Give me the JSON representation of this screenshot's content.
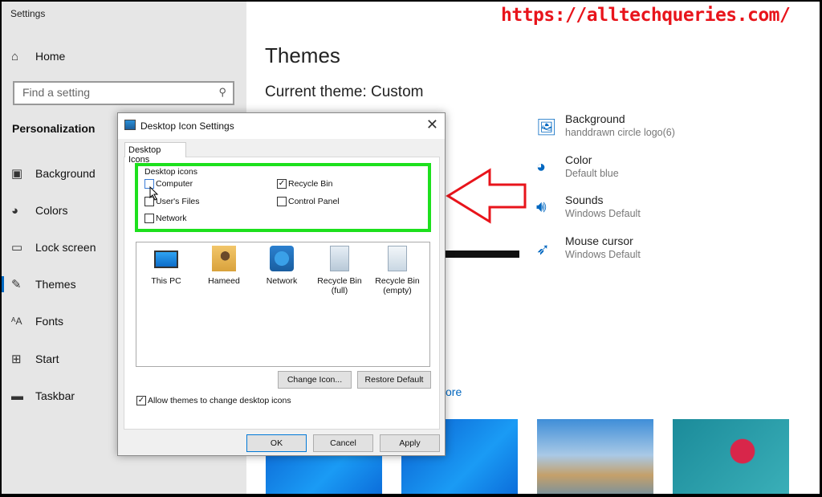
{
  "watermark_url": "https://alltechqueries.com/",
  "sidebar": {
    "app_title": "Settings",
    "home": "Home",
    "search_placeholder": "Find a setting",
    "section": "Personalization",
    "items": [
      {
        "label": "Background",
        "icon": "image-icon"
      },
      {
        "label": "Colors",
        "icon": "palette-icon"
      },
      {
        "label": "Lock screen",
        "icon": "lock-screen-icon"
      },
      {
        "label": "Themes",
        "icon": "themes-icon",
        "active": true
      },
      {
        "label": "Fonts",
        "icon": "fonts-icon"
      },
      {
        "label": "Start",
        "icon": "start-icon"
      },
      {
        "label": "Taskbar",
        "icon": "taskbar-icon"
      }
    ]
  },
  "main": {
    "title": "Themes",
    "current_theme": "Current theme: Custom",
    "settings": [
      {
        "title": "Background",
        "sub": "handdrawn circle logo(6)",
        "icon": "image-icon"
      },
      {
        "title": "Color",
        "sub": "Default blue",
        "icon": "palette-icon"
      },
      {
        "title": "Sounds",
        "sub": "Windows Default",
        "icon": "speaker-icon"
      },
      {
        "title": "Mouse cursor",
        "sub": "Windows Default",
        "icon": "cursor-icon"
      }
    ],
    "partial_link": "ore",
    "accent": "#0067c0"
  },
  "dialog": {
    "title": "Desktop Icon Settings",
    "tab": "Desktop Icons",
    "group_label": "Desktop icons",
    "checkboxes": [
      {
        "label": "Computer",
        "checked": false
      },
      {
        "label": "User's Files",
        "checked": false
      },
      {
        "label": "Network",
        "checked": false
      },
      {
        "label": "Recycle Bin",
        "checked": true
      },
      {
        "label": "Control Panel",
        "checked": false
      }
    ],
    "icons": [
      {
        "label": "This PC"
      },
      {
        "label": "Hameed"
      },
      {
        "label": "Network"
      },
      {
        "label": "Recycle Bin\n(full)"
      },
      {
        "label": "Recycle Bin\n(empty)"
      }
    ],
    "change_icon": "Change Icon...",
    "restore_default": "Restore Default",
    "allow_themes": "Allow themes to change desktop icons",
    "allow_themes_checked": true,
    "ok": "OK",
    "cancel": "Cancel",
    "apply": "Apply"
  },
  "highlight_color": "#1de01d",
  "arrow_color": "#e8141b"
}
